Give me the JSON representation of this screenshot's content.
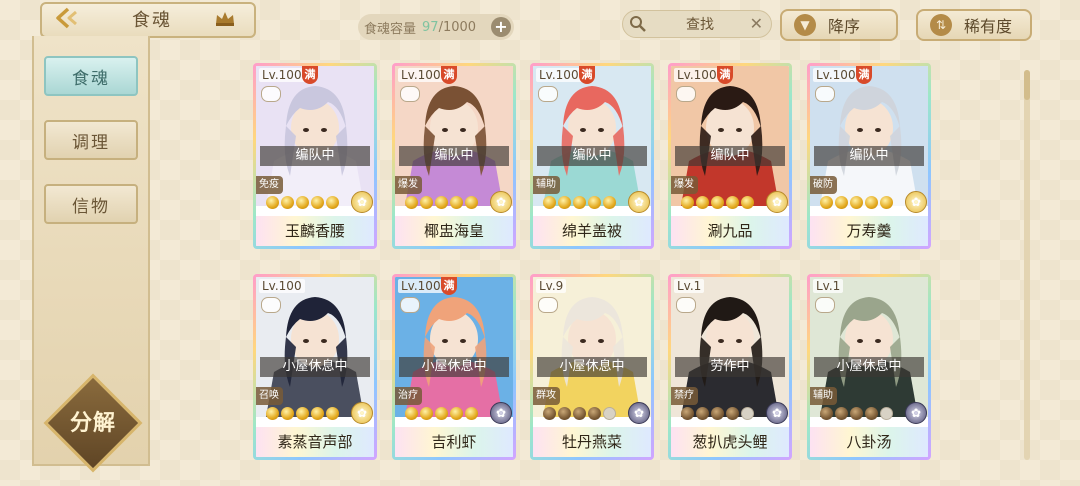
{
  "header": {
    "tab_title": "食魂",
    "capacity": {
      "label": "食魂容量",
      "current": "97",
      "max": "/1000"
    },
    "search": {
      "placeholder": "查找"
    },
    "sort_order_label": "降序",
    "sort_field_label": "稀有度"
  },
  "sidebar": {
    "items": [
      {
        "label": "食魂",
        "active": true
      },
      {
        "label": "调理",
        "active": false
      },
      {
        "label": "信物",
        "active": false
      }
    ],
    "decompose_label": "分解"
  },
  "cards": [
    {
      "level": "Lv.100",
      "max_badge": "满",
      "status": "编队中",
      "role": "免疫",
      "name": "玉麟香腰",
      "stars": 5,
      "star_style": "gold",
      "element": "gold",
      "palette": [
        "#e9e2f4",
        "#c9c7de",
        "#f2eef9"
      ]
    },
    {
      "level": "Lv.100",
      "max_badge": "满",
      "status": "编队中",
      "role": "爆发",
      "name": "椰盅海皇",
      "stars": 5,
      "star_style": "gold",
      "element": "gold",
      "palette": [
        "#f5d7c6",
        "#7a5134",
        "#c58ad6"
      ]
    },
    {
      "level": "Lv.100",
      "max_badge": "满",
      "status": "编队中",
      "role": "辅助",
      "name": "绵羊盖被",
      "stars": 5,
      "star_style": "gold",
      "element": "gold",
      "palette": [
        "#d8e8f2",
        "#e8685f",
        "#9bd9d4"
      ]
    },
    {
      "level": "Lv.100",
      "max_badge": "满",
      "status": "编队中",
      "role": "爆发",
      "name": "涮九品",
      "stars": 5,
      "star_style": "gold",
      "element": "gold",
      "palette": [
        "#f1c7a6",
        "#2a1a14",
        "#c2372b"
      ]
    },
    {
      "level": "Lv.100",
      "max_badge": "满",
      "status": "编队中",
      "role": "破防",
      "name": "万寿羹",
      "stars": 5,
      "star_style": "gold",
      "element": "gold",
      "palette": [
        "#cfe0ef",
        "#cfd4dc",
        "#f5f7fa"
      ]
    },
    {
      "level": "Lv.100",
      "max_badge": "",
      "status": "小屋休息中",
      "role": "召唤",
      "name": "素蒸音声部",
      "stars": 5,
      "star_style": "gold",
      "element": "gold",
      "palette": [
        "#e9ecf1",
        "#1f2338",
        "#4a4f5f"
      ]
    },
    {
      "level": "Lv.100",
      "max_badge": "满",
      "status": "小屋休息中",
      "role": "治疗",
      "name": "吉利虾",
      "stars": 5,
      "star_style": "gold",
      "element": "dark",
      "palette": [
        "#6bb1e6",
        "#f0a37a",
        "#e56fa5"
      ]
    },
    {
      "level": "Lv.9",
      "max_badge": "",
      "status": "小屋休息中",
      "role": "群攻",
      "name": "牡丹燕菜",
      "stars": 4,
      "star_style": "dark",
      "element": "dark",
      "palette": [
        "#f6f0d8",
        "#ece6dc",
        "#f2d35f"
      ]
    },
    {
      "level": "Lv.1",
      "max_badge": "",
      "status": "劳作中",
      "role": "禁疗",
      "name": "葱扒虎头鲤",
      "stars": 4,
      "star_style": "dark",
      "element": "dark",
      "palette": [
        "#efe6d8",
        "#201915",
        "#2b2b30"
      ]
    },
    {
      "level": "Lv.1",
      "max_badge": "",
      "status": "小屋休息中",
      "role": "辅助",
      "name": "八卦汤",
      "stars": 4,
      "star_style": "dark",
      "element": "dark",
      "palette": [
        "#dfe7d6",
        "#9aa58c",
        "#2e3a34"
      ]
    }
  ]
}
